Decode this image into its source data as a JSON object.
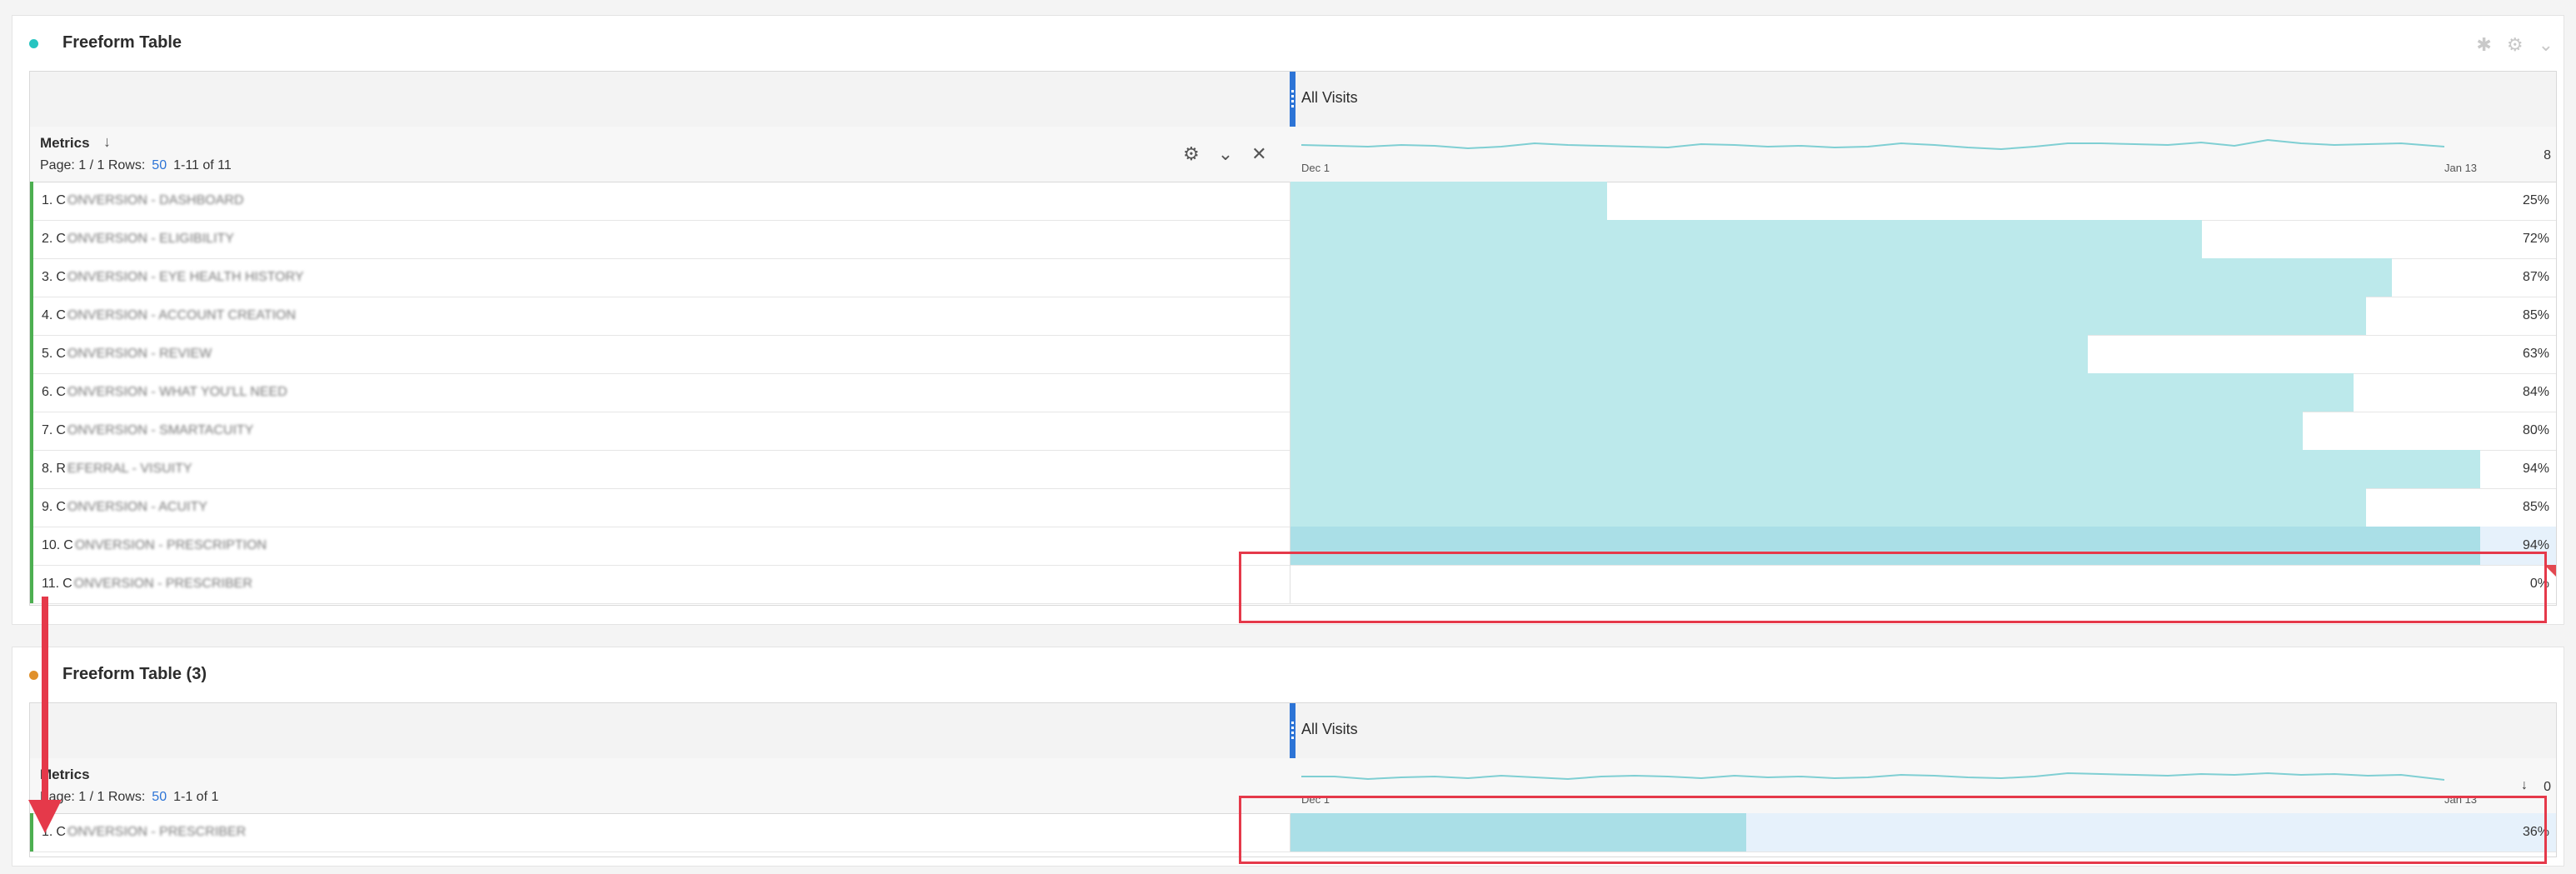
{
  "panels": [
    {
      "title": "Freeform Table",
      "dot_color": "#26c4c0",
      "column_title": "All Visits",
      "metrics_label": "Metrics",
      "pager": {
        "page": "Page: 1 / 1",
        "rows_label": "Rows:",
        "rows": "50",
        "range": "1-11 of 11"
      },
      "spark_start": "Dec 1",
      "spark_end": "Jan 13",
      "spark_total": "8",
      "rows": [
        {
          "num": "1.",
          "first": "C",
          "blur": "ONVERSION - DASHBOARD",
          "fill": 0.25,
          "pct": "25%"
        },
        {
          "num": "2.",
          "first": "C",
          "blur": "ONVERSION - ELIGIBILITY",
          "fill": 0.72,
          "pct": "72%"
        },
        {
          "num": "3.",
          "first": "C",
          "blur": "ONVERSION - EYE HEALTH HISTORY",
          "fill": 0.87,
          "pct": "87%"
        },
        {
          "num": "4.",
          "first": "C",
          "blur": "ONVERSION - ACCOUNT CREATION",
          "fill": 0.85,
          "pct": "85%"
        },
        {
          "num": "5.",
          "first": "C",
          "blur": "ONVERSION - REVIEW",
          "fill": 0.63,
          "pct": "63%"
        },
        {
          "num": "6.",
          "first": "C",
          "blur": "ONVERSION - WHAT YOU'LL NEED",
          "fill": 0.84,
          "pct": "84%"
        },
        {
          "num": "7.",
          "first": "C",
          "blur": "ONVERSION - SMARTACUITY",
          "fill": 0.8,
          "pct": "80%"
        },
        {
          "num": "8.",
          "first": "R",
          "blur": "EFERRAL - VISUITY",
          "fill": 0.94,
          "pct": "94%"
        },
        {
          "num": "9.",
          "first": "C",
          "blur": "ONVERSION - ACUITY",
          "fill": 0.85,
          "pct": "85%"
        },
        {
          "num": "10.",
          "first": "C",
          "blur": "ONVERSION - PRESCRIPTION",
          "fill": 0.94,
          "pct": "94%"
        },
        {
          "num": "11.",
          "first": "C",
          "blur": "ONVERSION - PRESCRIBER",
          "fill": 0.0,
          "pct": "0%"
        }
      ]
    },
    {
      "title": "Freeform Table (3)",
      "dot_color": "#e0902b",
      "column_title": "All Visits",
      "metrics_label": "Metrics",
      "pager": {
        "page": "Page: 1 / 1",
        "rows_label": "Rows:",
        "rows": "50",
        "range": "1-1 of 1"
      },
      "spark_start": "Dec 1",
      "spark_end": "Jan 13",
      "spark_total": "0",
      "rows": [
        {
          "num": "1.",
          "first": "C",
          "blur": "ONVERSION - PRESCRIBER",
          "fill": 0.36,
          "pct": "36%"
        }
      ]
    }
  ],
  "colors": {
    "fill": "#bce9eb",
    "highlight": "#e5394a",
    "accent": "#2d74d6",
    "row_indicator": "#4caf50"
  }
}
